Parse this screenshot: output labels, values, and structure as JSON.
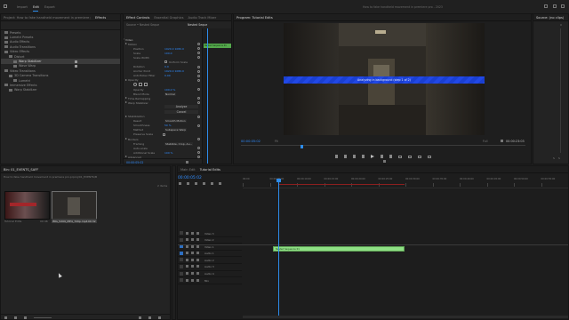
{
  "menubar": {
    "items": [
      "Import",
      "Edit",
      "Export"
    ],
    "title": "How to fake handheld movement in premiere pro - 2023"
  },
  "effects_panel": {
    "tabs": [
      "Project: How to fake handheld movement in premiere pro prproj",
      "Effects"
    ],
    "items": [
      {
        "label": "Presets",
        "selected": false,
        "indent": 0
      },
      {
        "label": "Lumetri Presets",
        "selected": false,
        "indent": 0
      },
      {
        "label": "Audio Effects",
        "selected": false,
        "indent": 0
      },
      {
        "label": "Audio Transitions",
        "selected": false,
        "indent": 0
      },
      {
        "label": "Video Effects",
        "selected": false,
        "indent": 0
      },
      {
        "label": "Distort",
        "selected": false,
        "indent": 1
      },
      {
        "label": "Warp Stabilizer",
        "selected": true,
        "indent": 2
      },
      {
        "label": "Wave Warp",
        "selected": false,
        "indent": 2
      },
      {
        "label": "Video Transitions",
        "selected": false,
        "indent": 0
      },
      {
        "label": "3D Camera Transitions",
        "selected": false,
        "indent": 1
      },
      {
        "label": "Lumetri",
        "selected": false,
        "indent": 2
      },
      {
        "label": "Immersive Effects",
        "selected": false,
        "indent": 0
      },
      {
        "label": "Warp Stabilizer",
        "selected": false,
        "indent": 1
      }
    ]
  },
  "effect_controls": {
    "tabs": [
      "Effect Controls",
      "Essential Graphics",
      "Audio Track Mixer"
    ],
    "clip_label": "Source • Nested Seque",
    "seq_label": "Nested Seque",
    "clip_chip": "Nested Sequence 01",
    "props": [
      {
        "label": "Video",
        "value": "",
        "kind": "section"
      },
      {
        "label": "Motion",
        "value": "",
        "kind": "group"
      },
      {
        "label": "Position",
        "value": "1920.0  1080.0",
        "kind": "prop"
      },
      {
        "label": "Scale",
        "value": "100.0",
        "kind": "prop"
      },
      {
        "label": "Scale Width",
        "value": "",
        "kind": "prop"
      },
      {
        "label": "",
        "value": "Uniform Scale",
        "kind": "check"
      },
      {
        "label": "Rotation",
        "value": "0.0",
        "kind": "prop"
      },
      {
        "label": "Anchor Point",
        "value": "1920.0  1080.0",
        "kind": "prop"
      },
      {
        "label": "Anti-flicker Filter",
        "value": "0.00",
        "kind": "prop"
      },
      {
        "label": "Opacity",
        "value": "",
        "kind": "group"
      },
      {
        "label": "",
        "value": "",
        "kind": "shapes"
      },
      {
        "label": "Opacity",
        "value": "100.0 %",
        "kind": "prop"
      },
      {
        "label": "Blend Mode",
        "value": "Normal",
        "kind": "select"
      },
      {
        "label": "Time Remapping",
        "value": "",
        "kind": "group"
      },
      {
        "label": "Warp Stabilizer",
        "value": "",
        "kind": "group"
      },
      {
        "label": "",
        "value": "Analyze",
        "kind": "button"
      },
      {
        "label": "",
        "value": "Cancel",
        "kind": "button"
      },
      {
        "label": "Stabilization",
        "value": "",
        "kind": "group"
      },
      {
        "label": "Result",
        "value": "Smooth Motion",
        "kind": "select"
      },
      {
        "label": "Smoothness",
        "value": "50 %",
        "kind": "prop"
      },
      {
        "label": "Method",
        "value": "Subspace Warp",
        "kind": "select"
      },
      {
        "label": "Preserve Scale",
        "value": "",
        "kind": "check"
      },
      {
        "label": "Borders",
        "value": "",
        "kind": "group"
      },
      {
        "label": "Framing",
        "value": "Stabilize, Crop, Au...",
        "kind": "select"
      },
      {
        "label": "Auto-scale",
        "value": "",
        "kind": "prop"
      },
      {
        "label": "Additional Scale",
        "value": "100 %",
        "kind": "prop"
      },
      {
        "label": "Advanced",
        "value": "",
        "kind": "group"
      }
    ],
    "footer_time": "00:00:05:02"
  },
  "program_monitor": {
    "tab": "Program: Tutorial Edits",
    "banner": "Analyzing in background (step 1 of 2)",
    "timecode": "00:00:05:02",
    "fit": "Fit",
    "quality": "Full",
    "duration": "00:00:23:03"
  },
  "audio_meters": {
    "tab": "Source: (no clips)",
    "db_top": "0",
    "labels": [
      "S",
      "S"
    ]
  },
  "bin_panel": {
    "tabs": [
      "Bin: 01_EVENTS_SAFF"
    ],
    "path": "How to fake handheld movement in premiere pro.prproj/01_EVENTS/B",
    "count": "2 items",
    "clips": [
      {
        "name": "Tutorial Edits",
        "duration": "00:46"
      },
      {
        "name": "IMG_5209_MP4_720p.mp4",
        "duration": "00:32"
      }
    ]
  },
  "timeline": {
    "tabs": [
      "Main Edit",
      "Tutorial Edits"
    ],
    "timecode": "00:00:05:02",
    "ruler": [
      "00:00",
      "00:00:05:00",
      "00:00:10:00",
      "00:00:15:00",
      "00:00:20:00",
      "00:00:25:00",
      "00:00:30:00",
      "00:00:35:00",
      "00:00:40:00",
      "00:00:45:00",
      "00:00:50:00",
      "00:00:55:00",
      "00:01:00:00"
    ],
    "tracks": [
      {
        "name": "Video 3",
        "type": "video"
      },
      {
        "name": "Video 2",
        "type": "video"
      },
      {
        "name": "Video 1",
        "type": "video"
      },
      {
        "name": "Audio 1",
        "type": "audio"
      },
      {
        "name": "Audio 2",
        "type": "audio"
      },
      {
        "name": "Audio 3",
        "type": "audio"
      },
      {
        "name": "Audio 4",
        "type": "audio"
      },
      {
        "name": "Mix",
        "type": "mix"
      }
    ],
    "clip": {
      "label": "Nested Sequence 01"
    }
  },
  "colors": {
    "accent": "#2d8ceb",
    "clip_green": "#8fe085",
    "banner_blue": "#1a3fd1",
    "workarea_red": "#8c1f1f"
  }
}
